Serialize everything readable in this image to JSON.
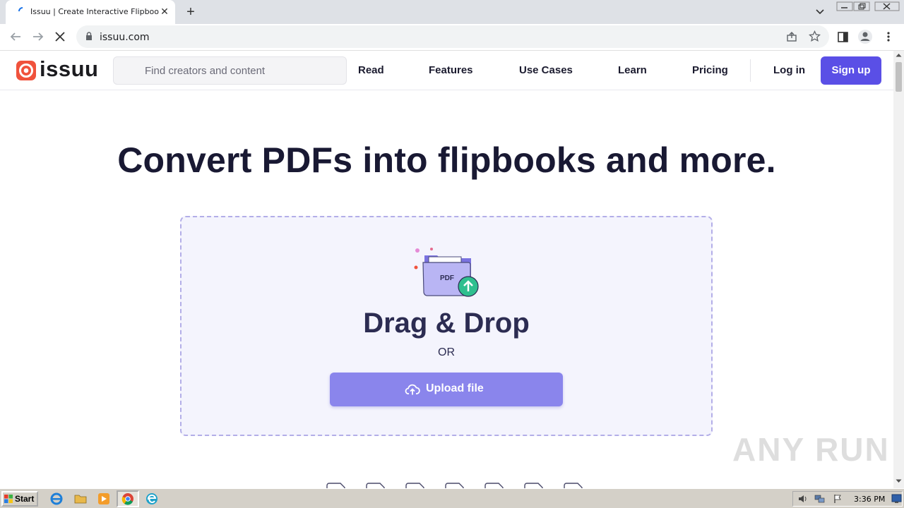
{
  "browser": {
    "tab_title": "Issuu | Create Interactive Flipbooks",
    "tab_close_glyph": "✕",
    "new_tab_glyph": "+",
    "url": "issuu.com"
  },
  "site": {
    "logo_text": "issuu",
    "search_placeholder": "Find creators and content",
    "nav": {
      "read": "Read",
      "features": "Features",
      "use_cases": "Use Cases",
      "learn": "Learn",
      "pricing": "Pricing",
      "login": "Log in",
      "signup": "Sign up"
    }
  },
  "hero": {
    "title": "Convert PDFs into flipbooks and more.",
    "pdf_label": "PDF",
    "drag_drop": "Drag & Drop",
    "or": "OR",
    "upload_label": "Upload file"
  },
  "watermark": "ANY RUN",
  "taskbar": {
    "start_label": "Start",
    "clock": "3:36 PM"
  },
  "colors": {
    "brand_red": "#f0523c",
    "accent_purple": "#5a4fe6",
    "upload_button": "#8a85ec",
    "dropzone_bg": "#f4f4fd"
  }
}
